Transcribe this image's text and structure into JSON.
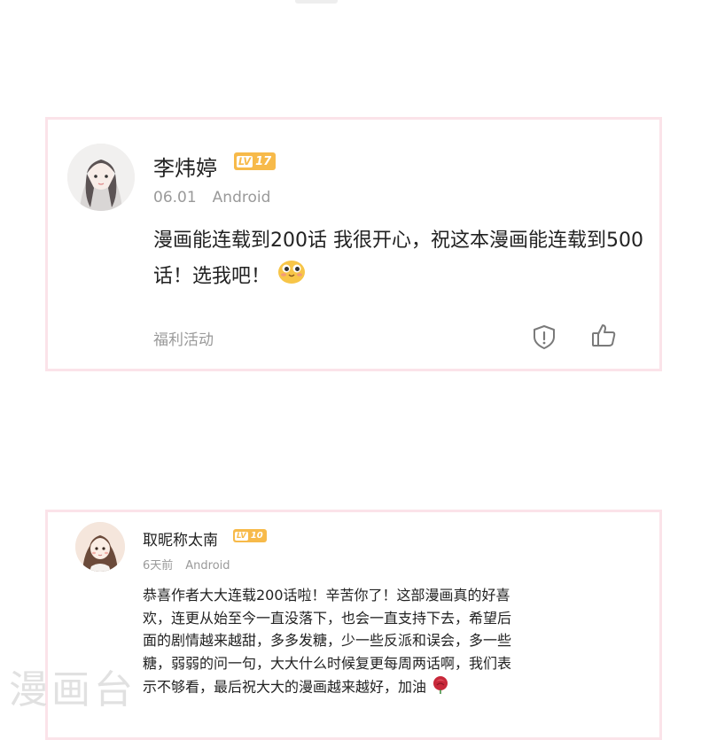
{
  "comments": [
    {
      "username": "李炜婷",
      "level": "17",
      "date": "06.01",
      "device": "Android",
      "content": "漫画能连载到200话 我很开心，祝这本漫画能连载到500话！选我吧！",
      "tag": "福利活动"
    },
    {
      "username": "取昵称太南",
      "level": "10",
      "date": "6天前",
      "device": "Android",
      "content": "恭喜作者大大连载200话啦！辛苦你了！这部漫画真的好喜欢，连更从始至今一直没落下，也会一直支持下去，希望后面的剧情越来越甜，多多发糖，少一些反派和误会，多一些糖，弱弱的问一句，大大什么时候复更每周两话啊，我们表示不够看，最后祝大大的漫画越来越好，加油"
    }
  ],
  "level_prefix": "LV",
  "watermark": "漫画台",
  "icons": {
    "report": "report-shield-icon",
    "like": "thumbs-up-icon",
    "emoji": "smiling-face-emoji-icon",
    "rose": "rose-emoji-icon"
  },
  "colors": {
    "card_border": "#fbe3e9",
    "level_badge": "#f7ba4a",
    "meta_text": "#9a9a9a"
  }
}
